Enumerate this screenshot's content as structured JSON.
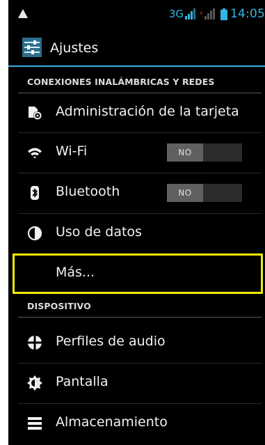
{
  "status_bar": {
    "network_type": "3G",
    "time": "14:05"
  },
  "action_bar": {
    "title": "Ajustes",
    "icon": "settings-sliders-icon"
  },
  "sections": {
    "wireless": "CONEXIONES INALÁMBRICAS Y REDES",
    "device": "DISPOSITIVO"
  },
  "items": {
    "sim_management": {
      "label": "Administración de la tarjeta",
      "icon": "sim-settings-icon"
    },
    "wifi": {
      "label": "Wi-Fi",
      "icon": "wifi-icon",
      "toggle": "NO"
    },
    "bluetooth": {
      "label": "Bluetooth",
      "icon": "bluetooth-icon",
      "toggle": "NO"
    },
    "data_usage": {
      "label": "Uso de datos",
      "icon": "data-usage-icon"
    },
    "more": {
      "label": "Más..."
    },
    "audio_profiles": {
      "label": "Perfiles de audio",
      "icon": "audio-profiles-icon"
    },
    "display": {
      "label": "Pantalla",
      "icon": "display-brightness-icon"
    },
    "storage": {
      "label": "Almacenamiento",
      "icon": "storage-icon"
    }
  },
  "colors": {
    "accent": "#33b5e5",
    "highlight": "#f4ec00",
    "background": "#000000",
    "toggle_off": "#606060"
  }
}
